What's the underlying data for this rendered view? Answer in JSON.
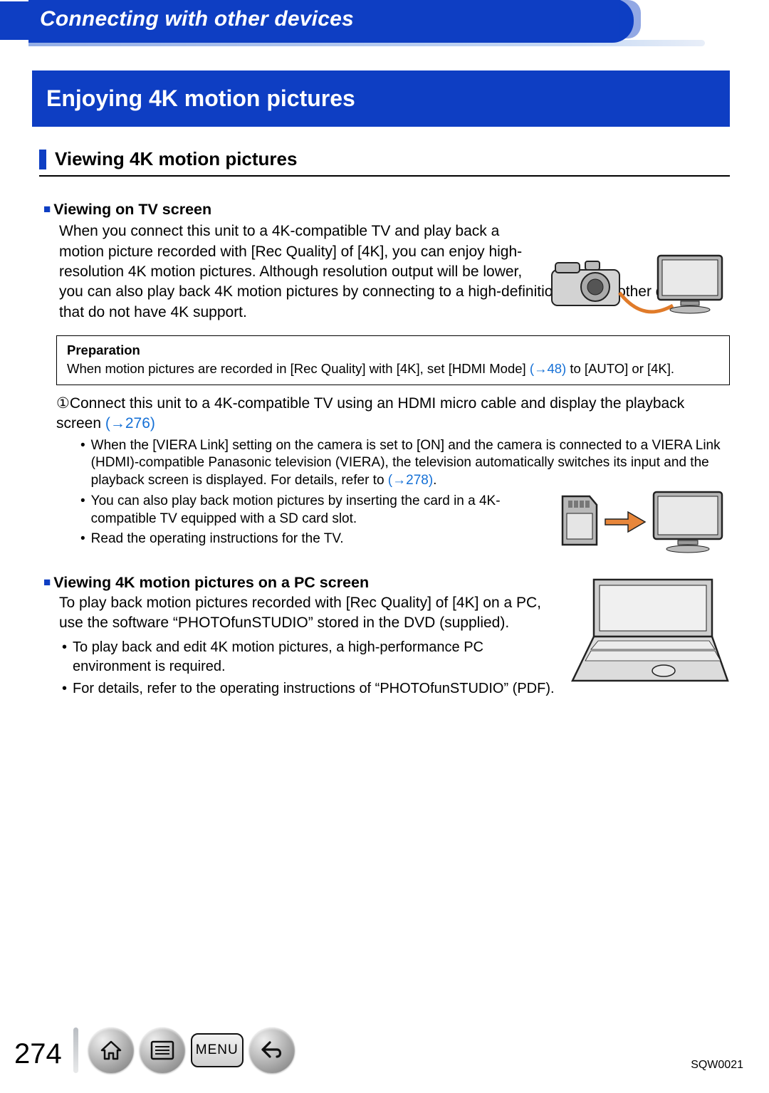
{
  "chapter": "Connecting with other devices",
  "title": "Enjoying 4K motion pictures",
  "subheading": "Viewing 4K motion pictures",
  "tv_section": {
    "heading": "Viewing on TV screen",
    "body": "When you connect this unit to a 4K-compatible TV and play back a motion picture recorded with [Rec Quality] of [4K], you can enjoy high-resolution 4K motion pictures. Although resolution output will be lower, you can also play back 4K motion pictures by connecting to a high-definition TV and other devices that do not have 4K support."
  },
  "preparation": {
    "heading": "Preparation",
    "text_before": "When motion pictures are recorded in [Rec Quality] with [4K], set [HDMI Mode] ",
    "link": "(→48)",
    "text_after": " to [AUTO] or [4K]."
  },
  "step1": {
    "marker": "①",
    "text_before": "Connect this unit to a 4K-compatible TV using an HDMI micro cable and display the playback screen ",
    "link": "(→276)"
  },
  "step1_sub": {
    "a_before": "When the [VIERA Link] setting on the camera is set to [ON] and the camera is connected to a VIERA Link (HDMI)-compatible Panasonic television (VIERA), the television automatically switches its input and the playback screen is displayed. For details, refer to ",
    "a_link": "(→278)",
    "a_after": ".",
    "b": "You can also play back motion pictures by inserting the card in a 4K-compatible TV equipped with a SD card slot.",
    "c": "Read the operating instructions for the TV."
  },
  "pc_section": {
    "heading": "Viewing 4K motion pictures on a PC screen",
    "body": "To play back motion pictures recorded with [Rec Quality] of [4K] on a PC, use the software “PHOTOfunSTUDIO” stored in the DVD (supplied).",
    "sub_a": "To play back and edit 4K motion pictures, a high-performance PC environment is required.",
    "sub_b": "For details, refer to the operating instructions of “PHOTOfunSTUDIO” (PDF)."
  },
  "footer": {
    "page": "274",
    "menu": "MENU",
    "doc": "SQW0021"
  }
}
